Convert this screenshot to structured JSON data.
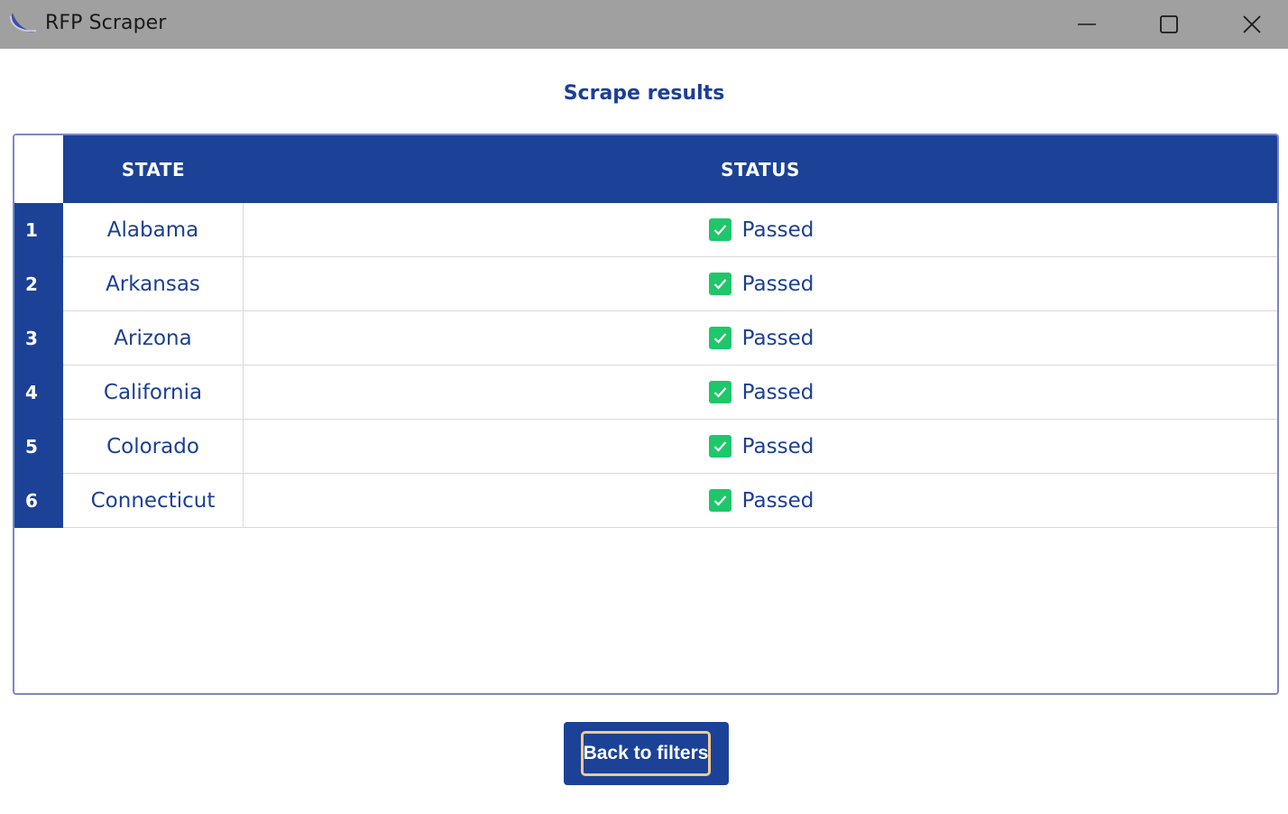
{
  "window": {
    "title": "RFP Scraper",
    "icon": "moon-swoosh-icon"
  },
  "heading": "Scrape results",
  "table": {
    "columns": [
      "STATE",
      "STATUS"
    ],
    "rows": [
      {
        "index": "1",
        "state": "Alabama",
        "status": "Passed"
      },
      {
        "index": "2",
        "state": "Arkansas",
        "status": "Passed"
      },
      {
        "index": "3",
        "state": "Arizona",
        "status": "Passed"
      },
      {
        "index": "4",
        "state": "California",
        "status": "Passed"
      },
      {
        "index": "5",
        "state": "Colorado",
        "status": "Passed"
      },
      {
        "index": "6",
        "state": "Connecticut",
        "status": "Passed"
      }
    ]
  },
  "back_button": {
    "label": "Back to filters"
  },
  "colors": {
    "primary": "#1c4298",
    "text_blue": "#1c3f94",
    "passed_green": "#1ec76a",
    "focus_ring": "#f3c98b",
    "titlebar": "#a0a0a0"
  }
}
